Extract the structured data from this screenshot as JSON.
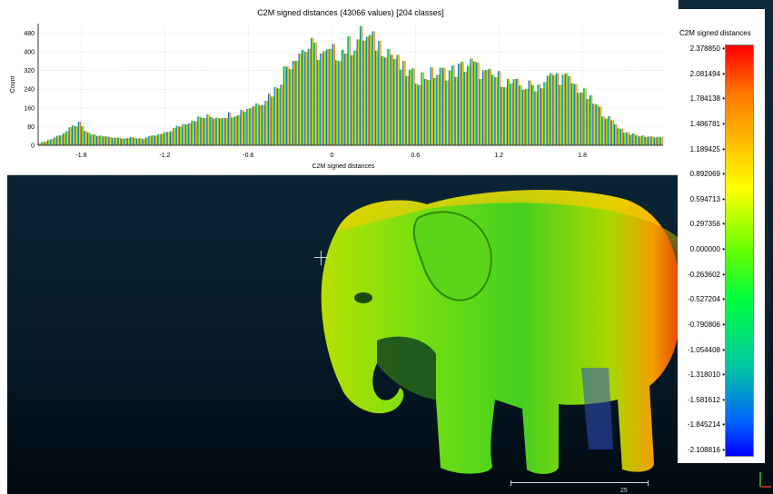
{
  "histogram": {
    "title": "C2M signed distances (43066 values)  [204 classes]",
    "xlabel": "C2M signed distances",
    "ylabel": "Count"
  },
  "scalar_field": {
    "title": "C2M signed distances",
    "labels": [
      "2.378850",
      "2.081494",
      "1.784138",
      "1.486781",
      "1.189425",
      "0.892069",
      "0.594713",
      "0.297356",
      "0.000000",
      "-0.263602",
      "-0.527204",
      "-0.790806",
      "-1.054408",
      "-1.318010",
      "-1.581612",
      "-1.845214",
      "-2.108816"
    ]
  },
  "scale": {
    "label": "25"
  },
  "chart_data": {
    "type": "bar",
    "title": "C2M signed distances (43066 values)  [204 classes]",
    "xlabel": "C2M signed distances",
    "ylabel": "Count",
    "xlim": [
      -2.11,
      2.38
    ],
    "ylim": [
      0,
      520
    ],
    "xticks": [
      -1.8,
      -1.2,
      -0.6,
      0,
      0.6,
      1.2,
      1.8
    ],
    "yticks": [
      0,
      80,
      160,
      240,
      320,
      400,
      480
    ],
    "bins": 204,
    "profile_x": [
      -2.11,
      -2.0,
      -1.9,
      -1.82,
      -1.75,
      -1.65,
      -1.5,
      -1.35,
      -1.2,
      -1.1,
      -1.0,
      -0.9,
      -0.8,
      -0.7,
      -0.6,
      -0.5,
      -0.4,
      -0.33,
      -0.25,
      -0.15,
      -0.05,
      0.05,
      0.15,
      0.22,
      0.3,
      0.4,
      0.5,
      0.6,
      0.7,
      0.8,
      0.9,
      1.0,
      1.1,
      1.2,
      1.3,
      1.4,
      1.5,
      1.6,
      1.7,
      1.8,
      1.9,
      2.0,
      2.1,
      2.2,
      2.38
    ],
    "profile_y": [
      5,
      30,
      60,
      95,
      50,
      38,
      32,
      30,
      50,
      80,
      110,
      120,
      125,
      135,
      160,
      190,
      240,
      330,
      400,
      420,
      380,
      400,
      430,
      470,
      440,
      420,
      330,
      290,
      300,
      310,
      320,
      350,
      300,
      290,
      260,
      250,
      260,
      300,
      280,
      230,
      170,
      110,
      60,
      40,
      35
    ]
  }
}
